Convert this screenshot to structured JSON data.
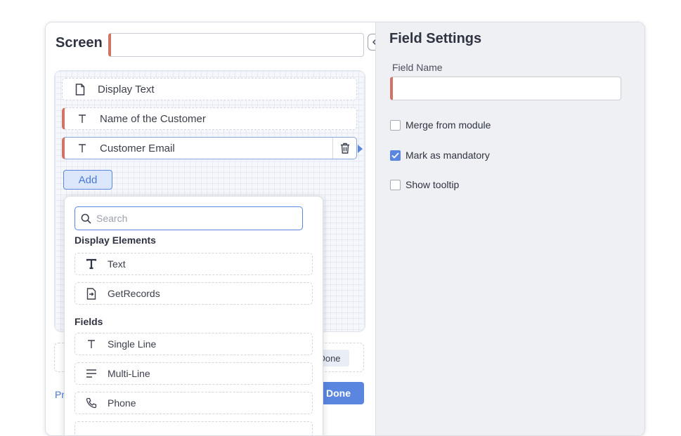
{
  "screen": {
    "title": "Screen",
    "name_value": ""
  },
  "fields": [
    {
      "label": "Display Text",
      "icon": "document-icon"
    },
    {
      "label": "Name of the Customer",
      "icon": "text-icon"
    },
    {
      "label": "Customer Email",
      "icon": "text-icon"
    }
  ],
  "add_label": "Add",
  "picker": {
    "search_placeholder": "Search",
    "display_section": "Display Elements",
    "display_items": [
      {
        "label": "Text",
        "icon": "bold-text-icon"
      },
      {
        "label": "GetRecords",
        "icon": "get-records-icon"
      }
    ],
    "fields_section": "Fields",
    "field_items": [
      {
        "label": "Single Line",
        "icon": "text-icon"
      },
      {
        "label": "Multi-Line",
        "icon": "lines-icon"
      },
      {
        "label": "Phone",
        "icon": "phone-icon"
      }
    ]
  },
  "footer": {
    "small_done": "Done",
    "prev_label": "Pr",
    "done_label": "Done"
  },
  "settings": {
    "title": "Field Settings",
    "field_name_label": "Field Name",
    "field_name_value": "",
    "options": [
      {
        "label": "Merge from module",
        "checked": false
      },
      {
        "label": "Mark as mandatory",
        "checked": true
      },
      {
        "label": "Show tooltip",
        "checked": false
      }
    ]
  },
  "colors": {
    "accent": "#5a86e0",
    "required": "#d17466",
    "panel_bg": "#eff0f4"
  }
}
